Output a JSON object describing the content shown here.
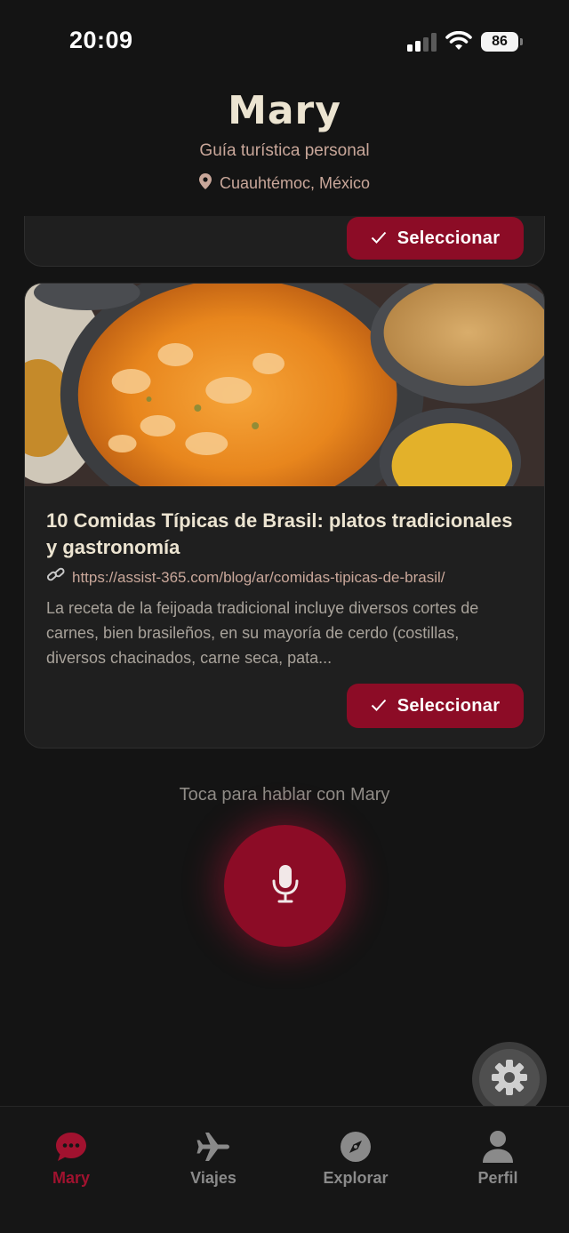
{
  "status_bar": {
    "time": "20:09",
    "battery": "86",
    "icons": [
      "signal-icon",
      "wifi-icon",
      "battery-icon"
    ]
  },
  "header": {
    "title": "Mary",
    "subtitle": "Guía turística personal",
    "location": "Cuauhtémoc, México",
    "location_icon": "map-pin-icon"
  },
  "results": {
    "select_label": "Seleccionar",
    "select_icon": "checkmark-icon",
    "items": [
      {
        "title": "10 Comidas Típicas de Brasil: platos tradicionales y gastronomía",
        "url": "https://assist-365.com/blog/ar/comidas-tipicas-de-brasil/",
        "description": "La receta de la feijoada tradicional incluye diversos cortes de carnes, bien brasileños, en su mayoría de cerdo (costillas, diversos chacinados, carne seca, pata...",
        "image": "food-photo"
      }
    ]
  },
  "voice": {
    "hint": "Toca para hablar con Mary",
    "icon": "microphone-icon"
  },
  "settings": {
    "icon": "gear-icon"
  },
  "tabbar": {
    "tabs": [
      {
        "label": "Mary",
        "icon": "chat-bubble-icon",
        "active": true
      },
      {
        "label": "Viajes",
        "icon": "airplane-icon",
        "active": false
      },
      {
        "label": "Explorar",
        "icon": "compass-icon",
        "active": false
      },
      {
        "label": "Perfil",
        "icon": "person-icon",
        "active": false
      }
    ]
  },
  "colors": {
    "background": "#141414",
    "card": "#1f1f1f",
    "accent": "#8c0c26",
    "title": "#ece4d1",
    "muted": "#c9a79a"
  }
}
